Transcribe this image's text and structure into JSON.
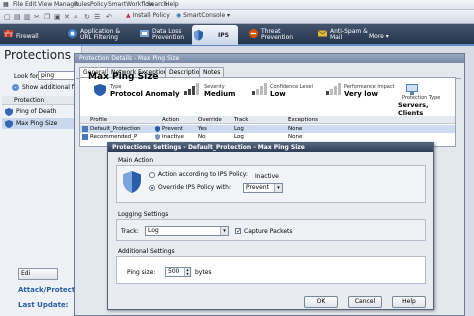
{
  "menubar": {
    "items": [
      "File",
      "Edit",
      "View",
      "Manage",
      "Rules",
      "Policy",
      "SmartWorkflow",
      "Search",
      "Help"
    ]
  },
  "toolbar": {
    "install_policy": "Install Policy",
    "smartconsole": "SmartConsole ▾"
  },
  "tabs": [
    {
      "label": "Firewall"
    },
    {
      "label": "Application & URL Filtering"
    },
    {
      "label": "Data Loss Prevention"
    },
    {
      "label": "IPS"
    },
    {
      "label": "Threat Prevention"
    },
    {
      "label": "Anti-Spam & Mail"
    },
    {
      "label": "More ▾"
    }
  ],
  "left": {
    "title": "Protections",
    "look_for_label": "Look for:",
    "look_for_value": "ping",
    "show_additional": "Show additional filt",
    "list_header": "Protection",
    "items": [
      "Ping of Death",
      "Max Ping Size"
    ],
    "edit_btn": "Edi",
    "attack_label": "Attack/Protecti",
    "last_update_label": "Last Update:"
  },
  "details": {
    "title": "Protection Details - Max Ping Size",
    "subtabs": [
      "General",
      "Network Exceptions",
      "Description",
      "Notes"
    ],
    "name": "Max Ping Size",
    "fields": [
      {
        "label": "Type",
        "value": "Protocol Anomaly"
      },
      {
        "label": "Severity",
        "value": "Medium"
      },
      {
        "label": "Confidence Level",
        "value": "Low"
      },
      {
        "label": "Performance Impact",
        "value": "Very low"
      },
      {
        "label": "Protection Type",
        "value": "Servers, Clients"
      }
    ],
    "table": {
      "headers": [
        "Profile",
        "Action",
        "Override",
        "Track",
        "Exceptions"
      ],
      "rows": [
        [
          "Default_Protection",
          "Prevent",
          "Yes",
          "Log",
          "None"
        ],
        [
          "Recommended_P",
          "Inactive",
          "No",
          "Log",
          "None"
        ]
      ]
    }
  },
  "settings": {
    "title": "Protections Settings - Default_Protection - Max Ping Size",
    "main_action_label": "Main Action",
    "radio_ips": "Action according to IPS Policy:",
    "ips_value": "Inactive",
    "radio_override": "Override IPS Policy with:",
    "override_value": "Prevent",
    "logging_label": "Logging Settings",
    "track_label": "Track:",
    "track_value": "Log",
    "capture_label": "Capture Packets",
    "additional_label": "Additional Settings",
    "ping_size_label": "Ping size:",
    "ping_size_value": "500",
    "bytes_label": "bytes",
    "ok": "OK",
    "cancel": "Cancel",
    "help": "Help"
  },
  "colors": {
    "tabbar": "#2f3d54",
    "accent": "#5c8bc6",
    "active_tab": "#dbe4f0"
  }
}
